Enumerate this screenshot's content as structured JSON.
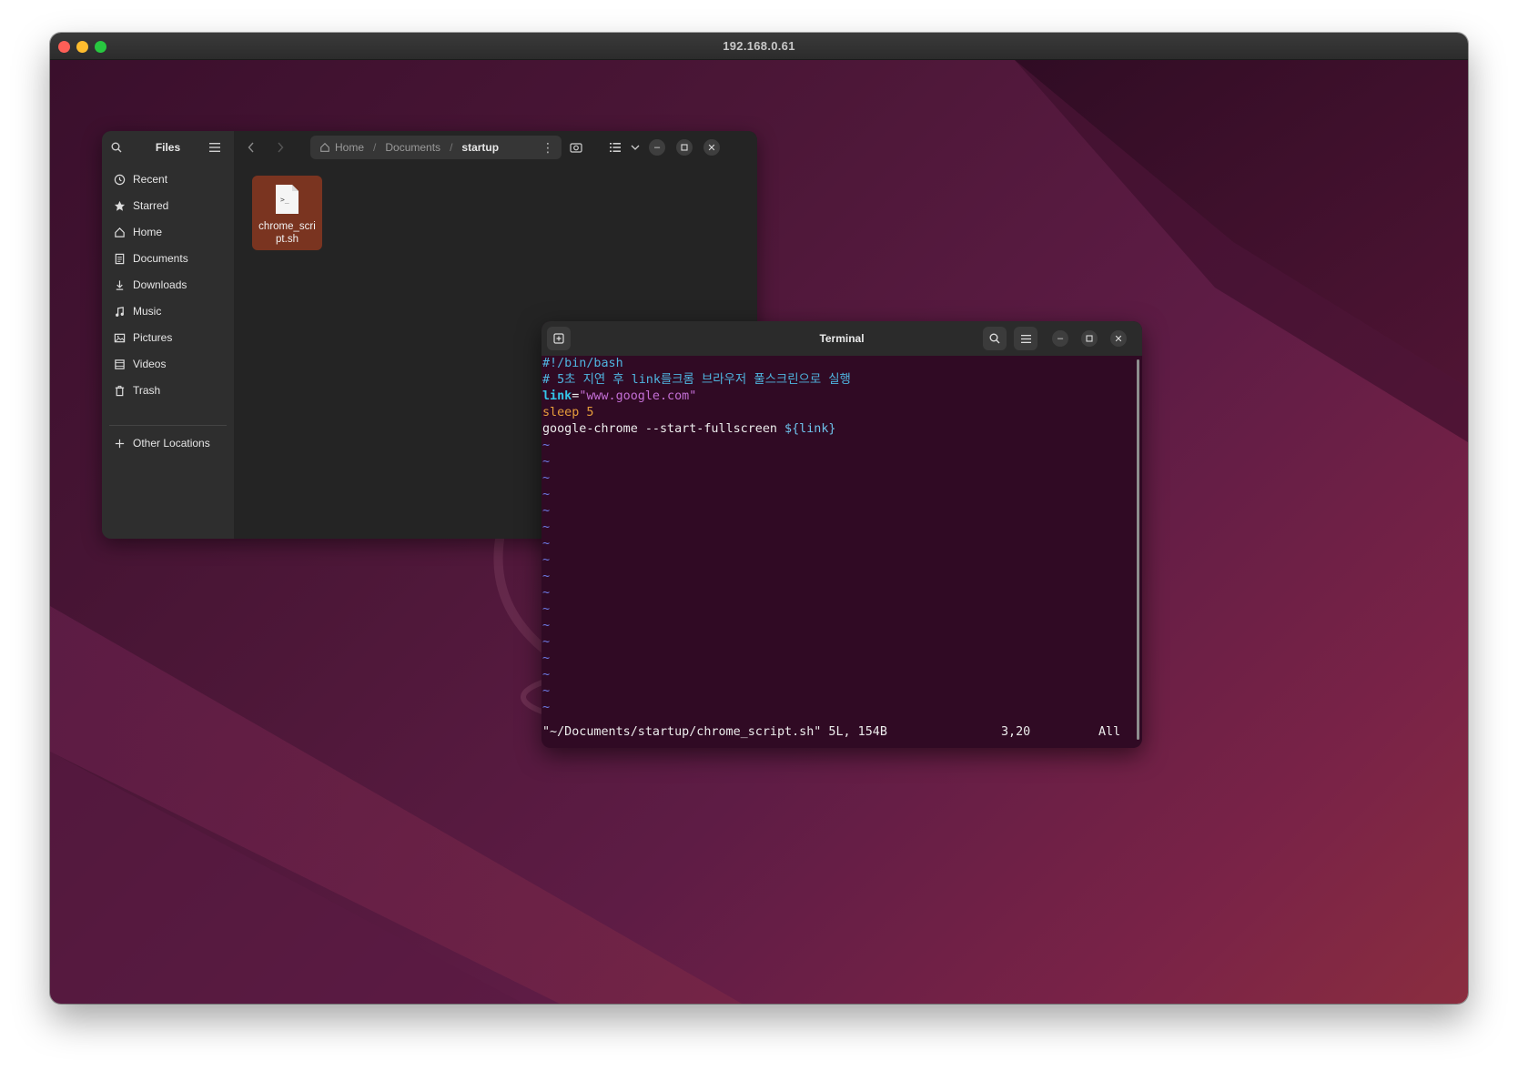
{
  "remote_window": {
    "title": "192.168.0.61"
  },
  "files": {
    "sidebar_title": "Files",
    "sidebar_items": [
      {
        "label": "Recent",
        "icon": "clock-icon"
      },
      {
        "label": "Starred",
        "icon": "star-icon"
      },
      {
        "label": "Home",
        "icon": "home-icon"
      },
      {
        "label": "Documents",
        "icon": "document-icon"
      },
      {
        "label": "Downloads",
        "icon": "download-icon"
      },
      {
        "label": "Music",
        "icon": "music-icon"
      },
      {
        "label": "Pictures",
        "icon": "picture-icon"
      },
      {
        "label": "Videos",
        "icon": "video-icon"
      },
      {
        "label": "Trash",
        "icon": "trash-icon"
      }
    ],
    "other_locations": "Other Locations",
    "path": [
      "Home",
      "Documents",
      "startup"
    ],
    "file_items": [
      {
        "name": "chrome_script.sh",
        "icon": "script-file-icon"
      }
    ]
  },
  "terminal": {
    "title": "Terminal",
    "lines": {
      "shebang": "#!/bin/bash",
      "comment": "# 5초 지연 후 link를크롬 브라우저 풀스크린으로 실행",
      "link_var": "link",
      "link_eq": "=",
      "link_value": "\"www.google.com\"",
      "sleep_kw": "sleep",
      "sleep_arg": " 5",
      "chrome_cmd": "google-chrome --start-fullscreen ",
      "chrome_arg": "${link}"
    },
    "tilde": "~",
    "tilde_count": 17,
    "status": {
      "file": "\"~/Documents/startup/chrome_script.sh\" 5L, 154B",
      "position": "3,20",
      "scroll": "All"
    }
  },
  "colors": {
    "terminal_bg": "#300a24",
    "comment": "#4fb5e0",
    "string": "#c46fd6",
    "keyword": "#e59c3b",
    "tilde": "#6d7be6",
    "file_tile": "#7a3420"
  }
}
